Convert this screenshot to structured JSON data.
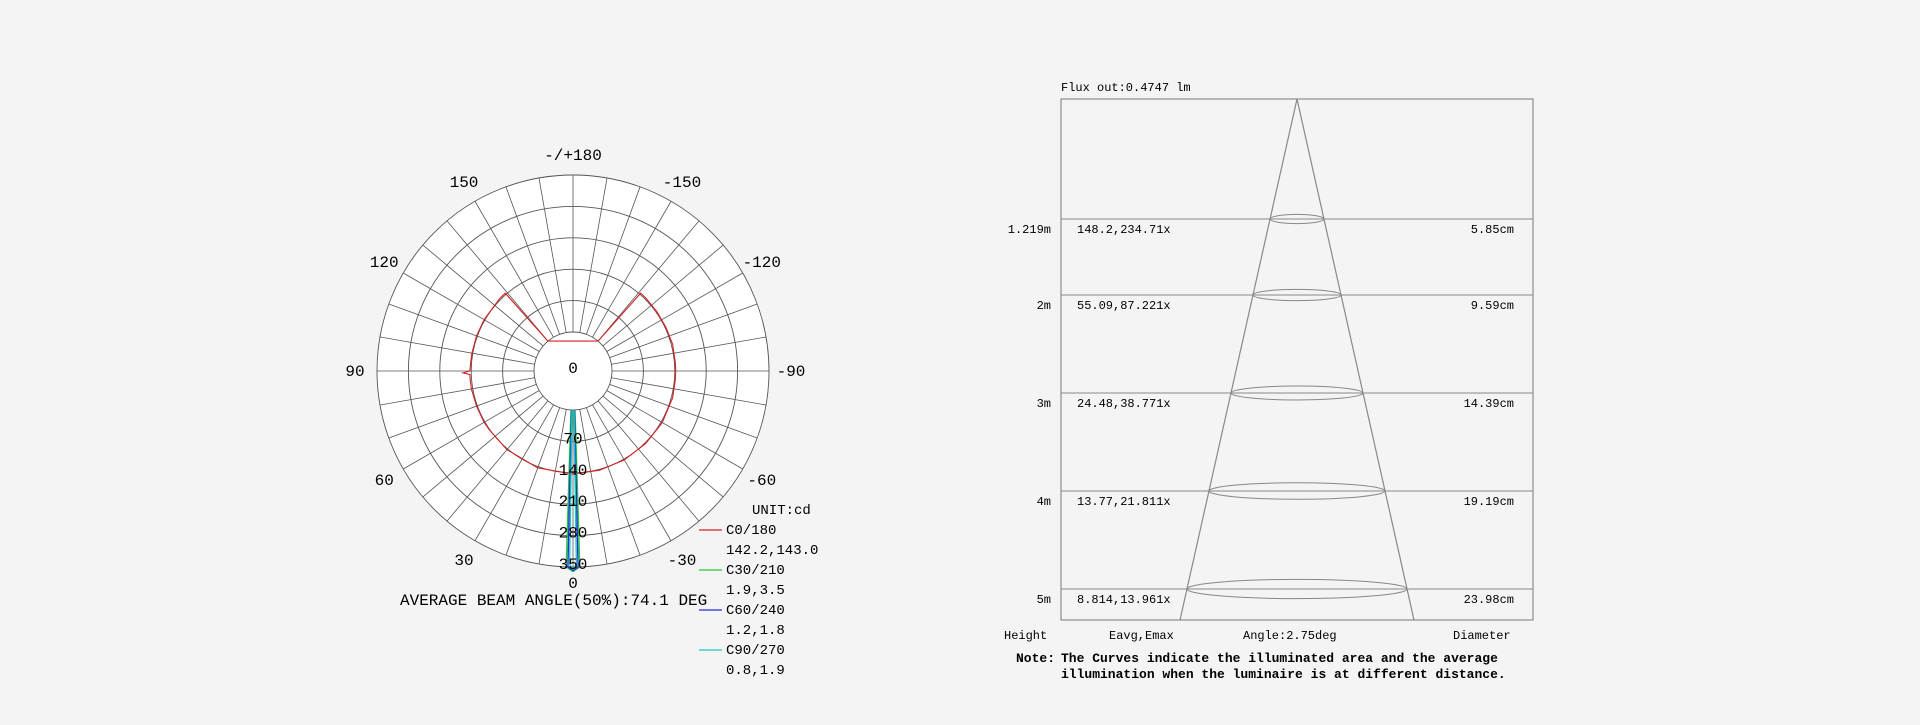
{
  "colors": {
    "background": "#f4f4f4",
    "grid": "#555555",
    "c0": "#d62020",
    "c30": "#22c83c",
    "c60": "#2b2bd6",
    "c90": "#18c8c8"
  },
  "chart_data": [
    {
      "type": "polar",
      "unit_label": "UNIT:cd",
      "angle_labels": [
        "-/+180",
        "150",
        "120",
        "90",
        "60",
        "30",
        "0",
        "-30",
        "-60",
        "-90",
        "-120",
        "-150"
      ],
      "radial_ticks": [
        "0",
        "70",
        "140",
        "210",
        "280",
        "350"
      ],
      "r_max": 350,
      "beam_angle_text": "AVERAGE BEAM ANGLE(50%):74.1 DEG",
      "legend": [
        {
          "name": "C0/180",
          "values": "142.2,143.0",
          "color": "#d62020"
        },
        {
          "name": "C30/210",
          "values": "1.9,3.5",
          "color": "#22c83c"
        },
        {
          "name": "C60/240",
          "values": "1.2,1.8",
          "color": "#2b2bd6"
        },
        {
          "name": "C90/270",
          "values": "0.8,1.9",
          "color": "#18c8c8"
        }
      ],
      "series": [
        {
          "name": "C0/180",
          "points": [
            [
              0,
              143
            ],
            [
              20,
              143
            ],
            [
              40,
              142
            ],
            [
              55,
              141
            ],
            [
              60,
              142
            ],
            [
              70,
              142
            ],
            [
              80,
              143
            ],
            [
              85,
              143
            ],
            [
              88,
              143
            ],
            [
              89,
              158
            ],
            [
              90,
              143
            ],
            [
              95,
              142
            ],
            [
              100,
              142
            ],
            [
              110,
              142
            ],
            [
              120,
              142
            ],
            [
              130,
              141
            ],
            [
              135,
              143
            ],
            [
              139,
              143
            ],
            [
              140,
              0
            ],
            [
              -140,
              0
            ],
            [
              -139,
              143
            ],
            [
              -135,
              143
            ],
            [
              -125,
              142
            ],
            [
              -115,
              142
            ],
            [
              -105,
              143
            ],
            [
              -95,
              142
            ],
            [
              -90,
              142
            ],
            [
              -85,
              142
            ],
            [
              -75,
              143
            ],
            [
              -60,
              143
            ],
            [
              -45,
              142
            ],
            [
              -30,
              142
            ],
            [
              -15,
              142
            ],
            [
              0,
              143
            ]
          ]
        },
        {
          "name": "C30/210",
          "points": [
            [
              -3,
              0
            ],
            [
              -2,
              350
            ],
            [
              0,
              360
            ],
            [
              2,
              350
            ],
            [
              3,
              0
            ]
          ]
        },
        {
          "name": "C60/240",
          "points": [
            [
              -2,
              0
            ],
            [
              -1.5,
              350
            ],
            [
              0,
              358
            ],
            [
              1.5,
              350
            ],
            [
              2,
              0
            ]
          ]
        },
        {
          "name": "C90/270",
          "points": [
            [
              -1.5,
              0
            ],
            [
              -1,
              345
            ],
            [
              0,
              355
            ],
            [
              1,
              345
            ],
            [
              1.5,
              0
            ]
          ]
        }
      ]
    },
    {
      "type": "table",
      "flux_text": "Flux out:0.4747 lm",
      "rows": [
        {
          "height": "1.219m",
          "eavg_emax": "148.2,234.71x",
          "diameter": "5.85cm"
        },
        {
          "height": "2m",
          "eavg_emax": "55.09,87.221x",
          "diameter": "9.59cm"
        },
        {
          "height": "3m",
          "eavg_emax": "24.48,38.771x",
          "diameter": "14.39cm"
        },
        {
          "height": "4m",
          "eavg_emax": "13.77,21.811x",
          "diameter": "19.19cm"
        },
        {
          "height": "5m",
          "eavg_emax": "8.814,13.961x",
          "diameter": "23.98cm"
        }
      ],
      "footer": {
        "height": "Height",
        "eavg_emax": "Eavg,Emax",
        "angle": "Angle:2.75deg",
        "diameter": "Diameter"
      },
      "note_label": "Note:",
      "note_line1": "The Curves indicate the illuminated area and the average",
      "note_line2": "illumination when the luminaire is at different distance."
    }
  ]
}
